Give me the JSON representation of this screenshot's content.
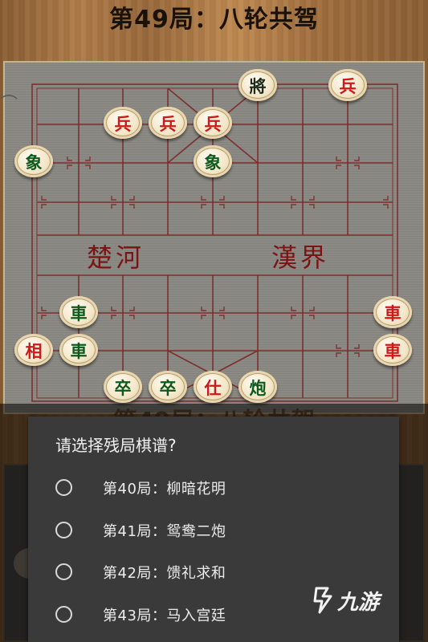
{
  "game_title": "第49局：八轮共驾",
  "river": {
    "left": "楚河",
    "right": "漢界"
  },
  "pieces": [
    {
      "char": "將",
      "side": "dark"
    },
    {
      "char": "兵",
      "side": "red"
    },
    {
      "char": "兵",
      "side": "red"
    },
    {
      "char": "兵",
      "side": "red"
    },
    {
      "char": "兵",
      "side": "red"
    },
    {
      "char": "象",
      "side": "green"
    },
    {
      "char": "象",
      "side": "green"
    },
    {
      "char": "車",
      "side": "green"
    },
    {
      "char": "車",
      "side": "red"
    },
    {
      "char": "相",
      "side": "red"
    },
    {
      "char": "車",
      "side": "green"
    },
    {
      "char": "車",
      "side": "red"
    },
    {
      "char": "卒",
      "side": "green"
    },
    {
      "char": "卒",
      "side": "green"
    },
    {
      "char": "仕",
      "side": "red"
    },
    {
      "char": "炮",
      "side": "green"
    }
  ],
  "dialog": {
    "title": "请选择残局棋谱?",
    "options": [
      {
        "label": "第40局：柳暗花明",
        "selected": false
      },
      {
        "label": "第41局：鸳鸯二炮",
        "selected": false
      },
      {
        "label": "第42局：馈礼求和",
        "selected": false
      },
      {
        "label": "第43局：马入宫廷",
        "selected": false
      }
    ]
  },
  "watermark": {
    "text": "九游",
    "icon": "jiuyou-logo-icon"
  },
  "colors": {
    "red_piece": "#d01818",
    "green_piece": "#0e5a1e",
    "dialog_bg": "#3a3a3a",
    "river_text": "#7a1414"
  }
}
